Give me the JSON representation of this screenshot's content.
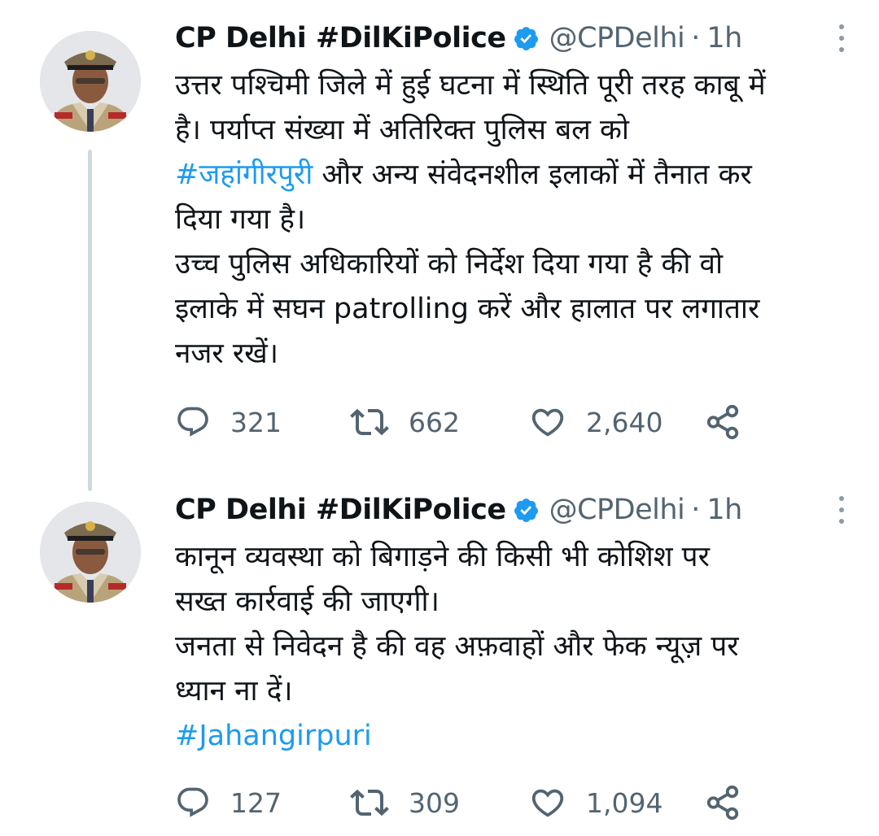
{
  "tweets": [
    {
      "author_name": "CP Delhi #DilKiPolice",
      "handle": "@CPDelhi",
      "separator": "·",
      "time": "1h",
      "lines": [
        {
          "parts": [
            {
              "text": "उत्तर पश्चिमी जिले में हुई घटना में स्थिति पूरी तरह काबू में",
              "hashtag": false
            }
          ]
        },
        {
          "parts": [
            {
              "text": "है। पर्याप्त संख्या में अतिरिक्त पुलिस बल को",
              "hashtag": false
            }
          ]
        },
        {
          "parts": [
            {
              "text": "#जहांगीरपुरी",
              "hashtag": true
            },
            {
              "text": " और अन्य संवेदनशील इलाकों में तैनात कर",
              "hashtag": false
            }
          ]
        },
        {
          "parts": [
            {
              "text": "दिया गया है।",
              "hashtag": false
            }
          ]
        },
        {
          "parts": [
            {
              "text": "उच्च पुलिस अधिकारियों को निर्देश दिया गया है की वो",
              "hashtag": false
            }
          ]
        },
        {
          "parts": [
            {
              "text": "इलाके में सघन patrolling करें और हालात पर लगातार",
              "hashtag": false
            }
          ]
        },
        {
          "parts": [
            {
              "text": "नजर रखें।",
              "hashtag": false
            }
          ]
        }
      ],
      "replies": "321",
      "retweets": "662",
      "likes": "2,640"
    },
    {
      "author_name": "CP Delhi #DilKiPolice",
      "handle": "@CPDelhi",
      "separator": "·",
      "time": "1h",
      "lines": [
        {
          "parts": [
            {
              "text": "कानून व्यवस्था को बिगाड़ने की किसी भी कोशिश पर",
              "hashtag": false
            }
          ]
        },
        {
          "parts": [
            {
              "text": "सख्त कार्रवाई की जाएगी।",
              "hashtag": false
            }
          ]
        },
        {
          "parts": [
            {
              "text": "जनता से निवेदन है की वह अफ़वाहों और फेक न्यूज़ पर",
              "hashtag": false
            }
          ]
        },
        {
          "parts": [
            {
              "text": "ध्यान ना दें।",
              "hashtag": false
            }
          ]
        },
        {
          "parts": [
            {
              "text": "#Jahangirpuri",
              "hashtag": true
            }
          ]
        }
      ],
      "replies": "127",
      "retweets": "309",
      "likes": "1,094"
    }
  ],
  "colors": {
    "text": "#0f1419",
    "secondary": "#536471",
    "link": "#1d9bf0",
    "verified": "#1d9bf0",
    "thread_line": "#cfd9de"
  },
  "icons": {
    "reply": "reply-icon",
    "retweet": "retweet-icon",
    "like": "heart-icon",
    "share": "share-icon",
    "verified": "verified-badge-icon",
    "more": "more-options-icon"
  }
}
